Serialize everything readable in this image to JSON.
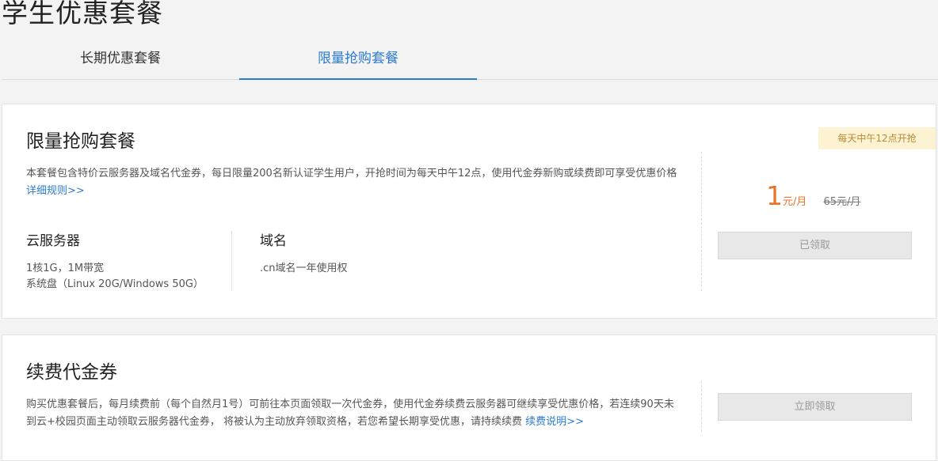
{
  "page": {
    "title": "学生优惠套餐"
  },
  "tabs": [
    {
      "label": "长期优惠套餐",
      "active": false
    },
    {
      "label": "限量抢购套餐",
      "active": true
    }
  ],
  "flash_package": {
    "title": "限量抢购套餐",
    "description": "本套餐包含特价云服务器及域名代金券，每日限量200名新认证学生用户，开抢时间为每天中午12点，使用代金券新购或续费即可享受优惠价格",
    "rules_link": "详细规则>>",
    "ribbon": "每天中午12点开抢",
    "price": {
      "amount": "1",
      "unit": "元/月",
      "original": "65元/月"
    },
    "button_label": "已领取",
    "specs": [
      {
        "heading": "云服务器",
        "lines": [
          "1核1G，1M带宽",
          "系统盘（Linux 20G/Windows 50G）"
        ]
      },
      {
        "heading": "域名",
        "lines": [
          ".cn域名一年使用权"
        ]
      }
    ]
  },
  "renewal_coupon": {
    "title": "续费代金券",
    "description": "购买优惠套餐后，每月续费前（每个自然月1号）可前往本页面领取一次代金券，使用代金券续费云服务器可继续享受优惠价格，若连续90天未到云+校园页面主动领取云服务器代金券， 将被认为主动放弃领取资格，若您希望长期享受优惠，请持续续费",
    "link": "续费说明>>",
    "button_label": "立即领取"
  },
  "colors": {
    "accent": "#2a7ad2",
    "price": "#e8742a",
    "ribbon_bg": "#fdf3d2",
    "ribbon_text": "#b68a34",
    "page_bg": "#f3f3f3"
  }
}
